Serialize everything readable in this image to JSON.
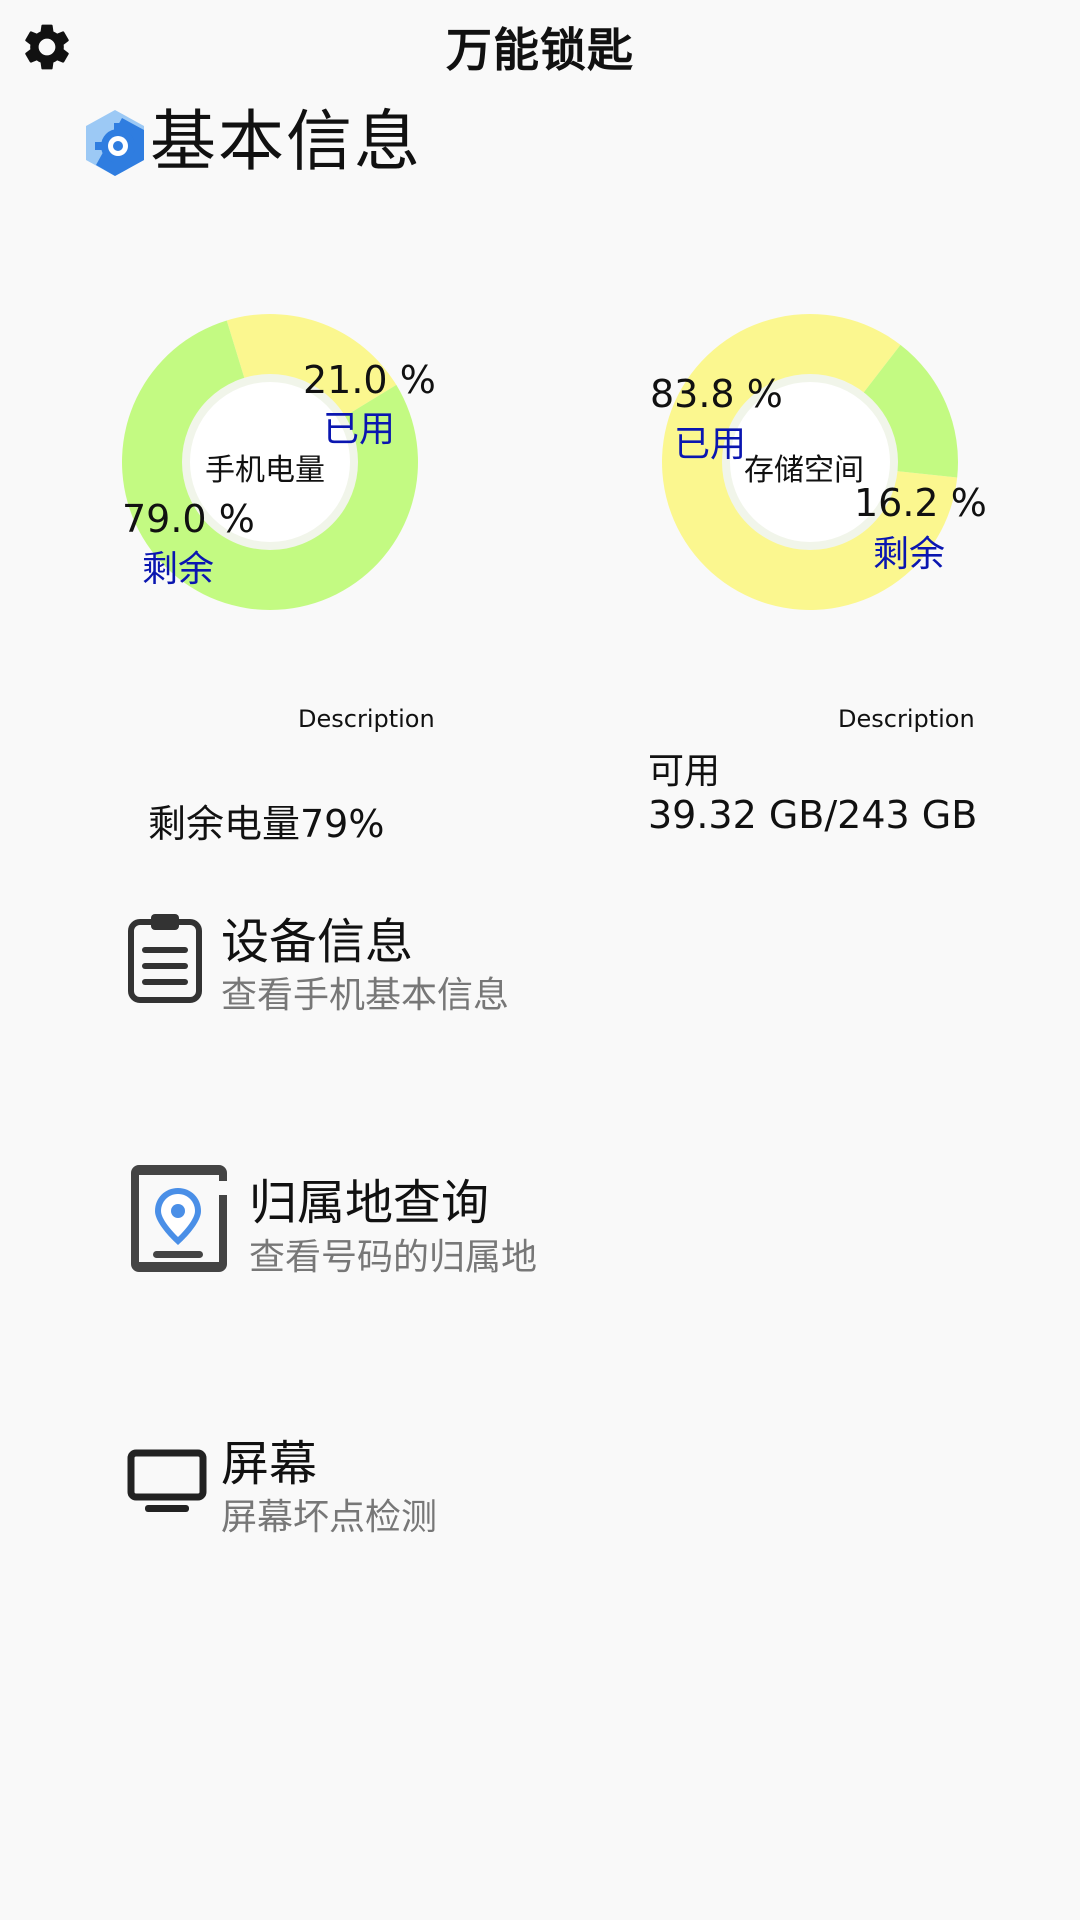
{
  "header": {
    "title": "万能锁匙",
    "settings_icon": "gear-icon"
  },
  "section": {
    "title": "基本信息",
    "icon": "settings-badge-icon"
  },
  "battery_chart": {
    "center_label": "手机电量",
    "used_pct_text": "21.0 %",
    "used_label": "已用",
    "remain_pct_text": "79.0 %",
    "remain_label": "剩余",
    "description": "Description",
    "summary": "剩余电量79%"
  },
  "storage_chart": {
    "center_label": "存储空间",
    "used_pct_text": "83.8 %",
    "used_label": "已用",
    "remain_pct_text": "16.2 %",
    "remain_label": "剩余",
    "description": "Description",
    "available_label": "可用",
    "available_value": "39.32 GB/243 GB"
  },
  "chart_data": [
    {
      "type": "pie",
      "title": "手机电量",
      "categories": [
        "已用",
        "剩余"
      ],
      "values": [
        21.0,
        79.0
      ],
      "colors": [
        "#fbf78f",
        "#c3fa82"
      ]
    },
    {
      "type": "pie",
      "title": "存储空间",
      "categories": [
        "已用",
        "剩余"
      ],
      "values": [
        83.8,
        16.2
      ],
      "colors": [
        "#fbf78f",
        "#c3fa82"
      ]
    }
  ],
  "menu": {
    "items": [
      {
        "title": "设备信息",
        "subtitle": "查看手机基本信息",
        "icon": "clipboard-icon"
      },
      {
        "title": "归属地查询",
        "subtitle": "查看号码的归属地",
        "icon": "location-pin-icon"
      },
      {
        "title": "屏幕",
        "subtitle": "屏幕坏点检测",
        "icon": "monitor-icon"
      }
    ]
  },
  "colors": {
    "used": "#fbf78f",
    "remain": "#c3fa82",
    "label_blue": "#0a16b0",
    "subtitle_gray": "#777777",
    "pin_blue": "#4a8fe7"
  }
}
